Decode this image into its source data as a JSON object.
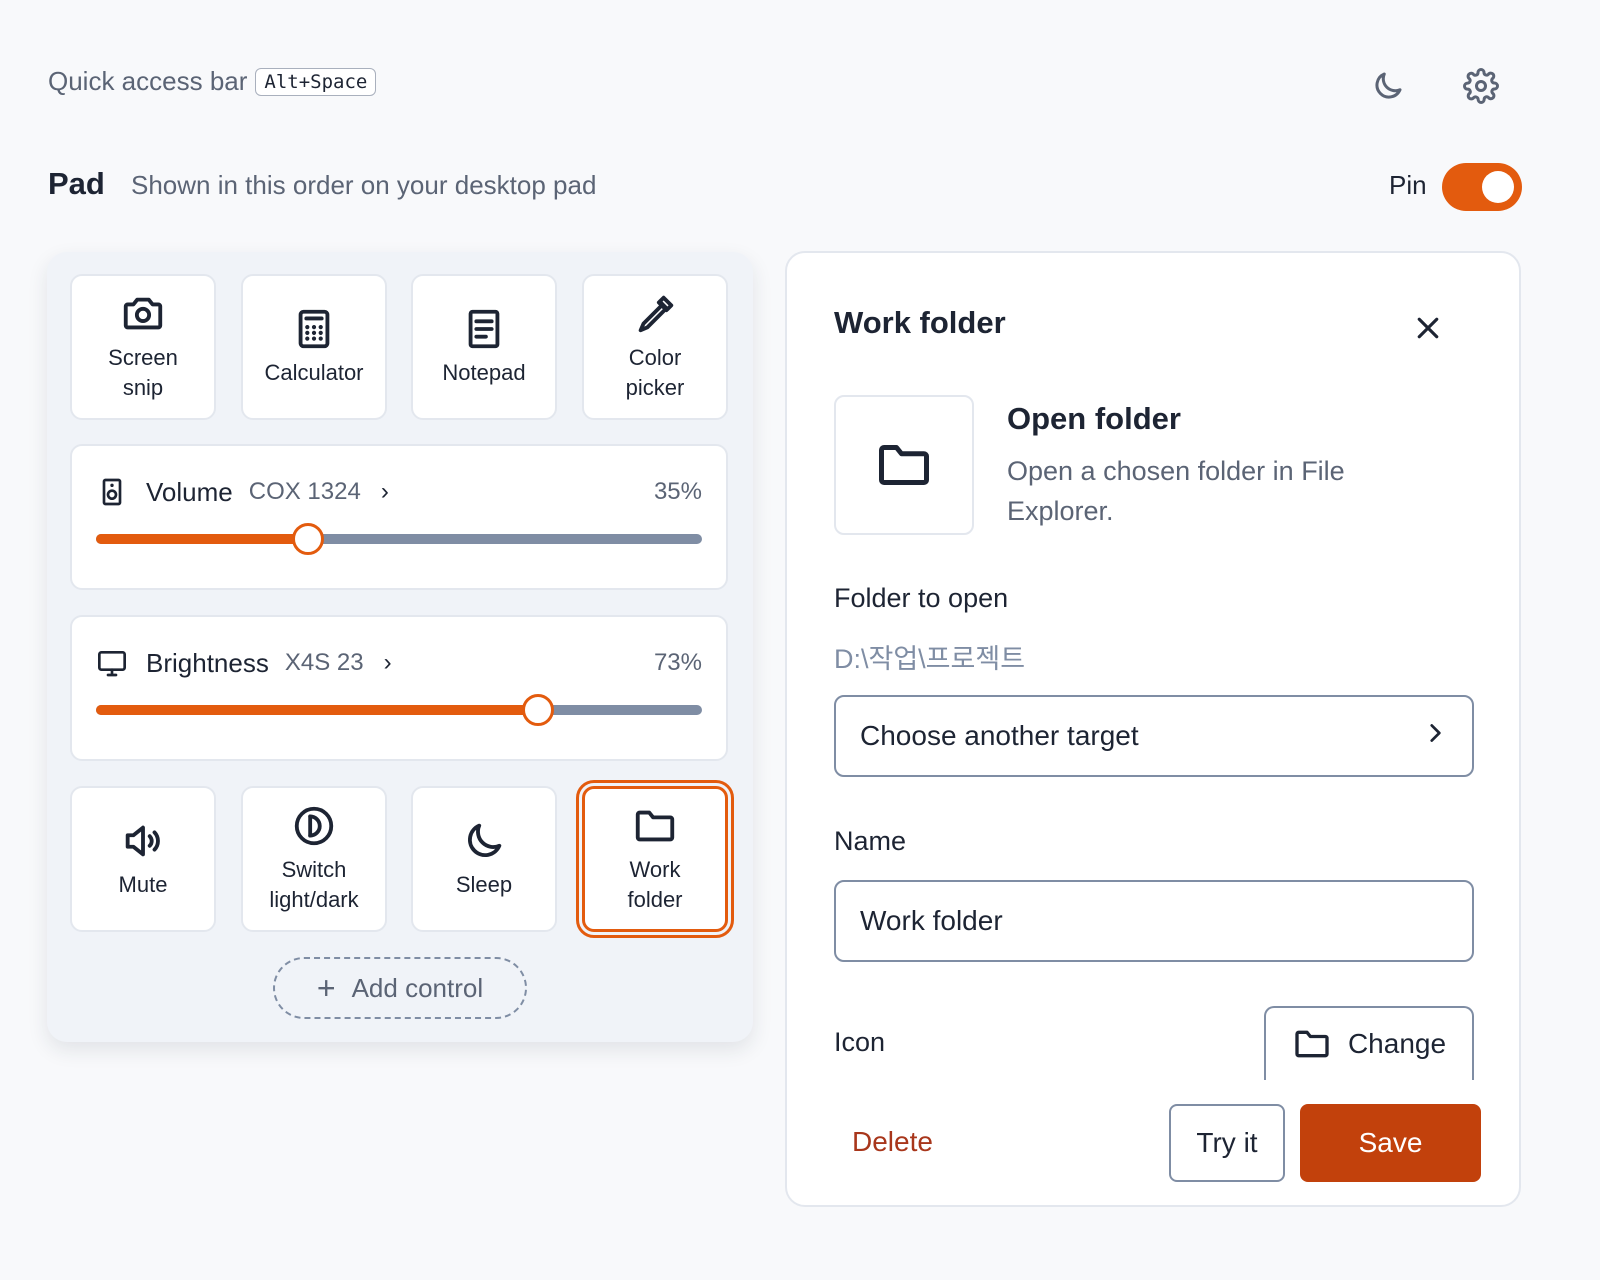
{
  "topbar": {
    "title": "Quick access bar",
    "shortcut": "Alt+Space",
    "theme_icon": "moon-icon",
    "settings_icon": "gear-icon"
  },
  "pad": {
    "title": "Pad",
    "subtitle": "Shown in this order on your desktop pad",
    "pin_label": "Pin",
    "pin_on": true,
    "tiles_top": [
      {
        "label": "Screen\nsnip",
        "icon": "camera-icon"
      },
      {
        "label": "Calculator",
        "icon": "calculator-icon"
      },
      {
        "label": "Notepad",
        "icon": "notepad-icon"
      },
      {
        "label": "Color\npicker",
        "icon": "eyedropper-icon"
      }
    ],
    "volume": {
      "name": "Volume",
      "device": "COX 1324",
      "value_text": "35%",
      "level": 0.35,
      "icon": "speaker-icon"
    },
    "brightness": {
      "name": "Brightness",
      "device": "X4S 23",
      "value_text": "73%",
      "level": 0.73,
      "icon": "monitor-icon"
    },
    "tiles_bottom": [
      {
        "label": "Mute",
        "icon": "volume-icon"
      },
      {
        "label": "Switch\nlight/dark",
        "icon": "contrast-icon"
      },
      {
        "label": "Sleep",
        "icon": "moon-icon"
      },
      {
        "label": "Work\nfolder",
        "icon": "folder-icon",
        "selected": true
      }
    ],
    "add_control": "Add control"
  },
  "detail": {
    "title": "Work folder",
    "action_title": "Open folder",
    "action_desc": "Open a chosen folder in File Explorer.",
    "folder_label": "Folder to open",
    "folder_path": "D:\\작업\\프로젝트",
    "choose_target": "Choose another target",
    "name_label": "Name",
    "name_value": "Work folder",
    "icon_label": "Icon",
    "change_label": "Change",
    "delete_label": "Delete",
    "try_label": "Try it",
    "save_label": "Save"
  },
  "colors": {
    "accent": "#e35b0e",
    "save": "#c2410c",
    "danger": "#a8361b",
    "track": "#7f8da4"
  }
}
